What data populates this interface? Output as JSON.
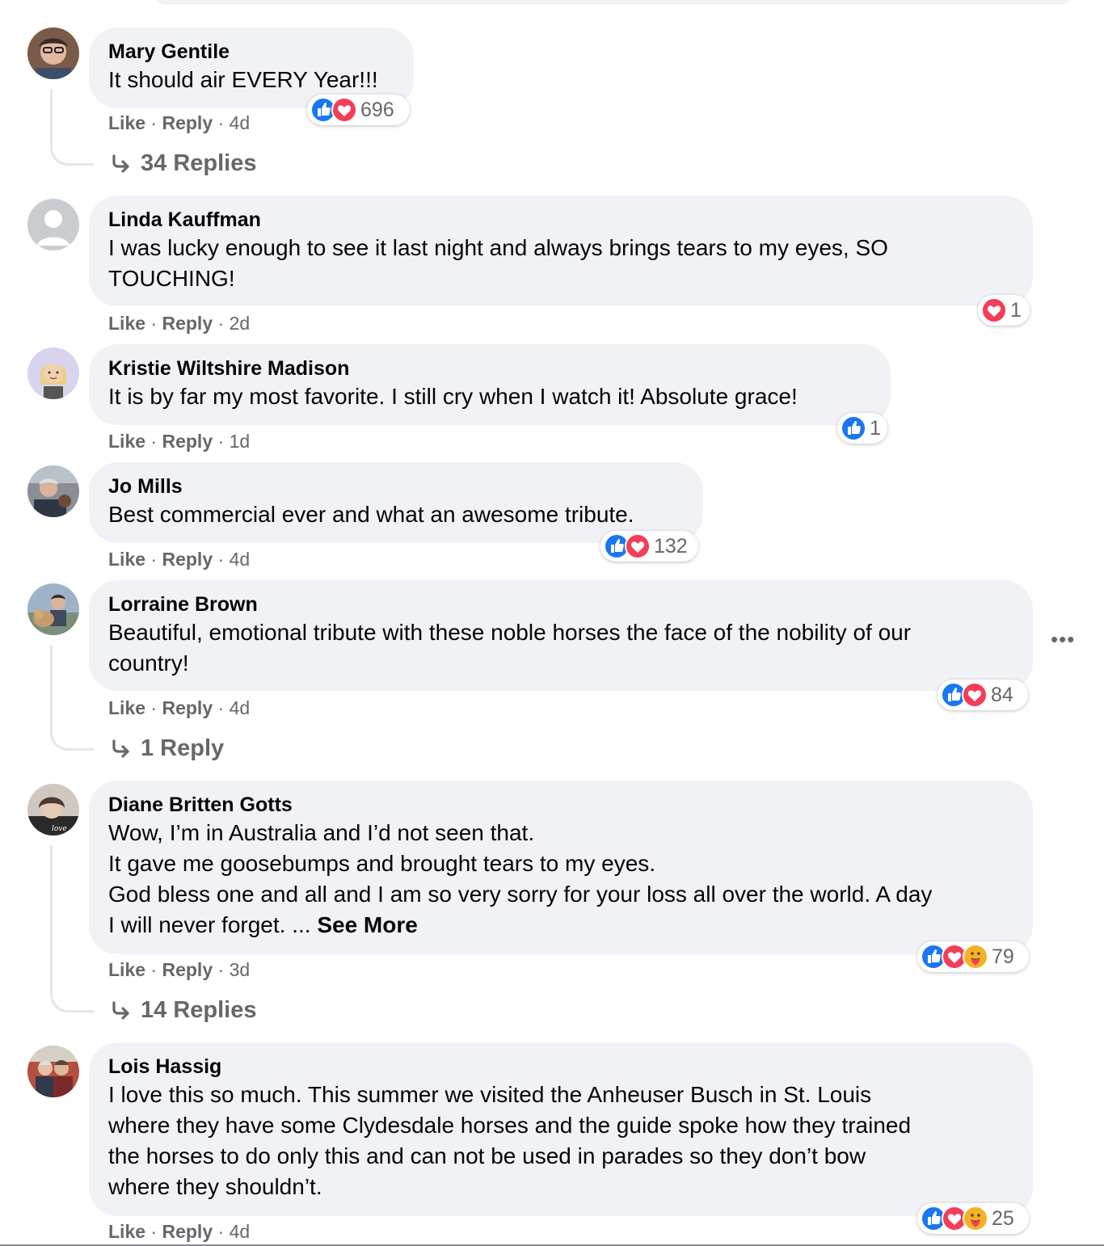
{
  "comments": [
    {
      "author": "Mary Gentile",
      "text": "It should air EVERY Year!!!",
      "actions": {
        "like": "Like",
        "reply": "Reply",
        "time": "4d"
      },
      "reactions": {
        "types": [
          "like-icon",
          "love-icon"
        ],
        "count": "696"
      },
      "replies_label": "34 Replies"
    },
    {
      "author": "Linda Kauffman",
      "text": "I was lucky enough to see it last night and always brings tears to my eyes, SO\nTOUCHING!",
      "actions": {
        "like": "Like",
        "reply": "Reply",
        "time": "2d"
      },
      "reactions": {
        "types": [
          "love-icon"
        ],
        "count": "1"
      }
    },
    {
      "author": "Kristie Wiltshire Madison",
      "text": "It is by far my most favorite. I still cry when I watch it! Absolute grace!",
      "actions": {
        "like": "Like",
        "reply": "Reply",
        "time": "1d"
      },
      "reactions": {
        "types": [
          "like-icon"
        ],
        "count": "1"
      }
    },
    {
      "author": "Jo Mills",
      "text": "Best commercial ever and what an awesome tribute.",
      "actions": {
        "like": "Like",
        "reply": "Reply",
        "time": "4d"
      },
      "reactions": {
        "types": [
          "like-icon",
          "love-icon"
        ],
        "count": "132"
      }
    },
    {
      "author": "Lorraine Brown",
      "text": "Beautiful, emotional tribute with these noble horses the face of the nobility of our\ncountry!",
      "actions": {
        "like": "Like",
        "reply": "Reply",
        "time": "4d"
      },
      "reactions": {
        "types": [
          "like-icon",
          "love-icon"
        ],
        "count": "84"
      },
      "replies_label": "1 Reply",
      "more_label": "•••"
    },
    {
      "author": "Diane Britten Gotts",
      "text": "Wow, I’m in Australia and I’d not seen that.\nIt gave me goosebumps and brought tears to my eyes.\nGod bless one and all and I am so very sorry for your loss all over the world. A day\nI will never forget. ... ",
      "see_more": "See More",
      "actions": {
        "like": "Like",
        "reply": "Reply",
        "time": "3d"
      },
      "reactions": {
        "types": [
          "like-icon",
          "love-icon",
          "care-icon"
        ],
        "count": "79"
      },
      "replies_label": "14 Replies"
    },
    {
      "author": "Lois Hassig",
      "text": "I love this so much. This summer we visited the Anheuser Busch in St. Louis\nwhere they have some Clydesdale horses and the guide spoke how they trained\nthe horses to do only this and can not be used in parades so they don’t bow\nwhere they shouldn’t.",
      "actions": {
        "like": "Like",
        "reply": "Reply",
        "time": "4d"
      },
      "reactions": {
        "types": [
          "like-icon",
          "love-icon",
          "care-icon"
        ],
        "count": "25"
      }
    }
  ],
  "colors": {
    "bubble": "#f0f2f5",
    "secondary_text": "#65676b",
    "like_blue": "#1877f2",
    "love_red": "#f33e58",
    "care_yellow": "#f7b125"
  }
}
